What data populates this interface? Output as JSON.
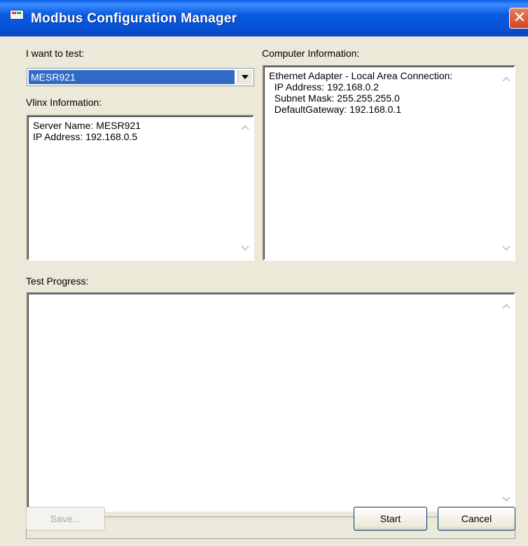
{
  "window": {
    "title": "Modbus Configuration Manager"
  },
  "test_selector": {
    "label": "I want to test:",
    "selected": "MESR921"
  },
  "vlinx": {
    "label": "Vlinx Information:",
    "lines": [
      "Server Name: MESR921",
      "IP Address: 192.168.0.5"
    ]
  },
  "computer": {
    "label": "Computer Information:",
    "lines": [
      "Ethernet Adapter - Local Area Connection:",
      "  IP Address: 192.168.0.2",
      "  Subnet Mask: 255.255.255.0",
      "  DefaultGateway: 192.168.0.1"
    ]
  },
  "progress": {
    "label": "Test Progress:",
    "value": 0
  },
  "buttons": {
    "save": "Save...",
    "start": "Start",
    "cancel": "Cancel"
  },
  "icons": {
    "close": "close-icon",
    "dropdown": "chevron-down-icon",
    "scroll_up": "scroll-up-icon",
    "scroll_down": "scroll-down-icon"
  }
}
